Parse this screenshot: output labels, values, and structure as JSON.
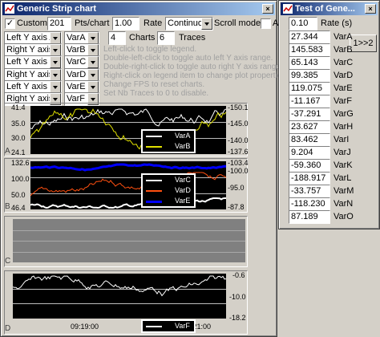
{
  "main_window": {
    "title": "Generic Strip chart",
    "custom_label": "Custom",
    "custom_checked": true,
    "pts_value": "201",
    "pts_label": "Pts/chart",
    "rate_value": "1.00",
    "rate_label": "Rate (s)",
    "mode_value": "Continuous",
    "scroll_mode_label": "Scroll mode",
    "align_label": "Align",
    "charts_value": "4",
    "charts_label": "Charts",
    "traces_value": "6",
    "traces_label": "Traces",
    "trace_rows": [
      {
        "axis": "Left Y axis A",
        "var": "VarA"
      },
      {
        "axis": "Right Y axis A",
        "var": "VarB"
      },
      {
        "axis": "Left Y axis B",
        "var": "VarC"
      },
      {
        "axis": "Right Y axis B",
        "var": "VarD"
      },
      {
        "axis": "Left Y axis B",
        "var": "VarE"
      },
      {
        "axis": "Right Y axis D",
        "var": "VarF"
      }
    ],
    "hints": [
      "Left-click to toggle legend.",
      "Double-left-click to toggle auto left Y axis range.",
      "Double-right-click to toggle auto right Y axis range.",
      "Right-click on legend item to change plot properties.",
      "Change FPS to reset charts.",
      "Set Nb Traces to 0 to disable."
    ]
  },
  "charts": {
    "A": {
      "letter": "A",
      "left_ticks": [
        "41.4",
        "35.0",
        "30.0",
        "24.1"
      ],
      "right_ticks": [
        "-150.1",
        "-145.0",
        "-140.0",
        "-137.6"
      ],
      "legend": [
        {
          "name": "VarA",
          "color": "#ffffff"
        },
        {
          "name": "VarB",
          "color": "#e0e000"
        }
      ]
    },
    "B": {
      "letter": "B",
      "left_ticks": [
        "132.6",
        "100.0",
        "50.0",
        "46.4"
      ],
      "right_ticks": [
        "-103.4",
        "-100.0",
        "-95.0",
        "-87.8"
      ],
      "legend": [
        {
          "name": "VarC",
          "color": "#ffffff"
        },
        {
          "name": "VarD",
          "color": "#ff5010"
        },
        {
          "name": "VarE",
          "color": "#0000ff"
        }
      ]
    },
    "C": {
      "letter": "C"
    },
    "D": {
      "letter": "D",
      "right_ticks": [
        "-0.6",
        "-10.0",
        "-18.2"
      ],
      "time_ticks": [
        "09:19:00",
        "09:21:00"
      ],
      "legend": [
        {
          "name": "VarF",
          "color": "#ffffff"
        }
      ]
    }
  },
  "test_window": {
    "title": "Test of Gene...",
    "rate_value": "0.10",
    "rate_label": "Rate (s)",
    "switch_label": "1>>2",
    "vars": [
      {
        "value": "27.344",
        "name": "VarA"
      },
      {
        "value": "145.583",
        "name": "VarB"
      },
      {
        "value": "65.143",
        "name": "VarC"
      },
      {
        "value": "99.385",
        "name": "VarD"
      },
      {
        "value": "119.075",
        "name": "VarE"
      },
      {
        "value": "-11.167",
        "name": "VarF"
      },
      {
        "value": "-37.291",
        "name": "VarG"
      },
      {
        "value": "23.627",
        "name": "VarH"
      },
      {
        "value": "83.462",
        "name": "VarI"
      },
      {
        "value": "9.204",
        "name": "VarJ"
      },
      {
        "value": "-59.360",
        "name": "VarK"
      },
      {
        "value": "-188.917",
        "name": "VarL"
      },
      {
        "value": "-33.757",
        "name": "VarM"
      },
      {
        "value": "-118.230",
        "name": "VarN"
      },
      {
        "value": "87.189",
        "name": "VarO"
      }
    ]
  }
}
